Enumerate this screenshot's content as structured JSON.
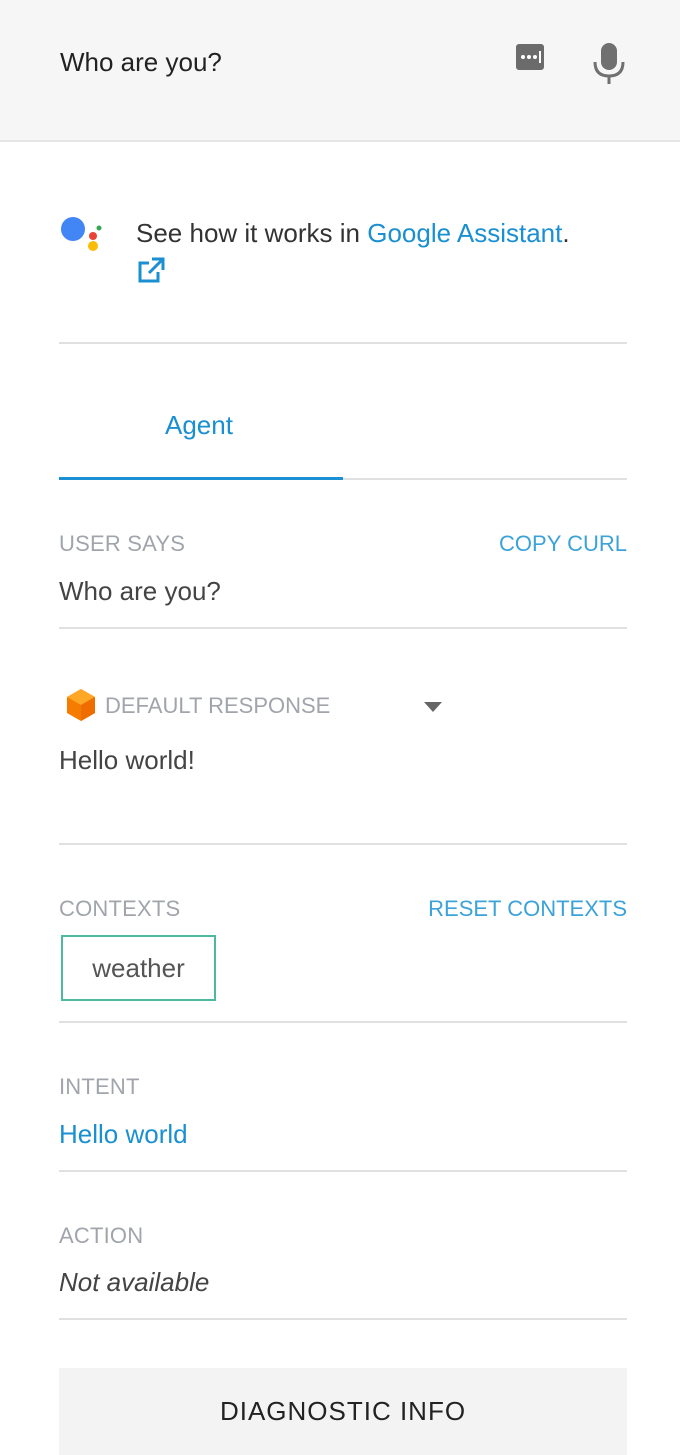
{
  "query": {
    "value": "Who are you?"
  },
  "icons": {
    "keyboard": "keyboard-icon",
    "mic": "microphone-icon",
    "assistant": "google-assistant-icon",
    "external": "external-link-icon",
    "cube": "dialogflow-cube-icon",
    "caret": "caret-down-icon"
  },
  "assistant": {
    "prefix": "See how it works in ",
    "link": "Google Assistant",
    "suffix": "."
  },
  "tabs": {
    "agent": "Agent"
  },
  "user_says": {
    "label": "USER SAYS",
    "action": "COPY CURL",
    "value": "Who are you?"
  },
  "response": {
    "label": "DEFAULT RESPONSE",
    "value": "Hello world!"
  },
  "contexts": {
    "label": "CONTEXTS",
    "action": "RESET CONTEXTS",
    "items": [
      "weather"
    ]
  },
  "intent": {
    "label": "INTENT",
    "value": "Hello world"
  },
  "action": {
    "label": "ACTION",
    "value": "Not available"
  },
  "diagnostic": {
    "label": "DIAGNOSTIC INFO"
  },
  "colors": {
    "accent": "#1a8fd1",
    "chip_border": "#4fb8a0",
    "cube": "#f57c00"
  }
}
